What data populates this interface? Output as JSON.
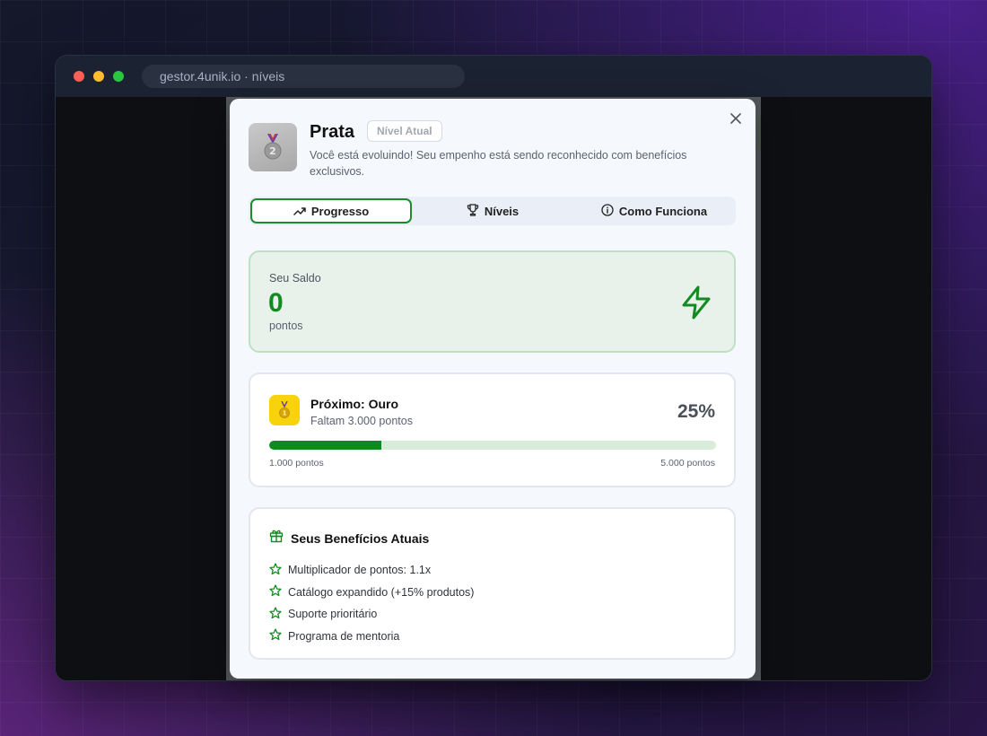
{
  "browser": {
    "url": "gestor.4unik.io · níveis"
  },
  "modal": {
    "level_name": "Prata",
    "current_tag": "Nível Atual",
    "description": "Você está evoluindo! Seu empenho está sendo reconhecido com benefícios exclusivos.",
    "close_icon": "close-icon",
    "tabs": [
      {
        "label": "Progresso",
        "icon": "trending-up-icon",
        "active": true
      },
      {
        "label": "Níveis",
        "icon": "trophy-icon",
        "active": false
      },
      {
        "label": "Como Funciona",
        "icon": "info-icon",
        "active": false
      }
    ],
    "balance": {
      "label": "Seu Saldo",
      "value": "0",
      "unit": "pontos",
      "icon": "bolt-icon"
    },
    "next_level": {
      "title": "Próximo: Ouro",
      "remaining": "Faltam 3.000 pontos",
      "percent_label": "25%",
      "progress_fraction": 0.25,
      "min_label": "1.000 pontos",
      "max_label": "5.000 pontos",
      "icon": "gold-medal-icon"
    },
    "benefits": {
      "title": "Seus Benefícios Atuais",
      "icon": "gift-icon",
      "items": [
        "Multiplicador de pontos: 1.1x",
        "Catálogo expandido (+15% produtos)",
        "Suporte prioritário",
        "Programa de mentoria"
      ]
    }
  },
  "colors": {
    "accent_green": "#138a22",
    "gold": "#f8d20a",
    "silver": "#b5b5b5"
  }
}
